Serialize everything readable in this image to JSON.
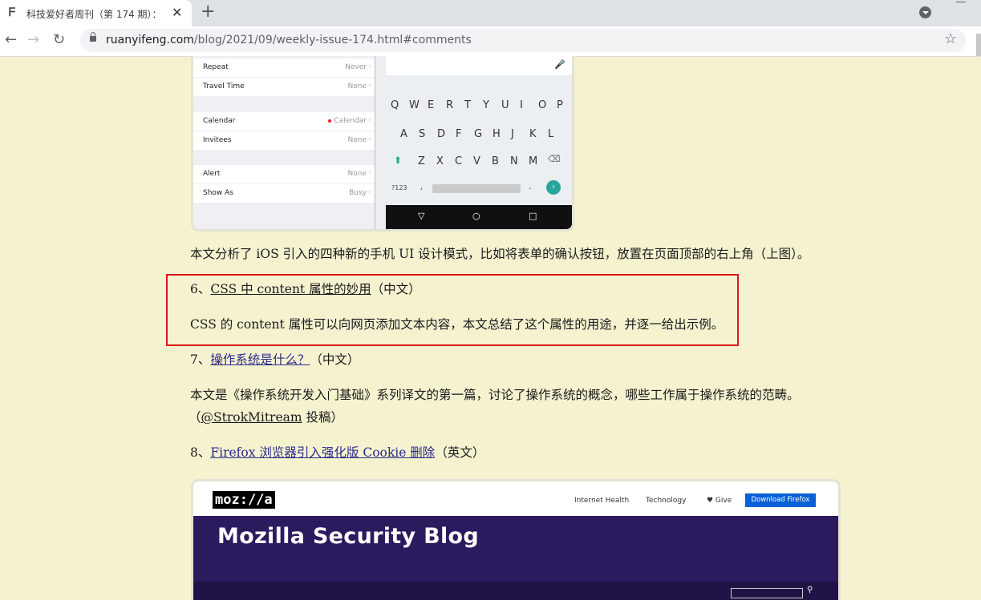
{
  "tab": {
    "favicon": "ᖴ",
    "title": "科技爱好者周刊（第 174 期）：",
    "close": "✕",
    "new_tab": "+"
  },
  "toolbar": {
    "back": "←",
    "forward": "→",
    "reload": "↻",
    "url_host": "ruanyifeng.com",
    "url_path": "/blog/2021/09/weekly-issue-174.html#comments",
    "bookmark": "☆"
  },
  "phone_figure": {
    "ios_rows": [
      {
        "label": "Repeat",
        "value": "Never"
      },
      {
        "label": "Travel Time",
        "value": "None"
      },
      {
        "label": "Calendar",
        "value": "Calendar"
      },
      {
        "label": "Invitees",
        "value": "None"
      },
      {
        "label": "Alert",
        "value": "None"
      },
      {
        "label": "Show As",
        "value": "Busy"
      }
    ],
    "keyboard": {
      "row1": [
        "Q",
        "W",
        "E",
        "R",
        "T",
        "Y",
        "U",
        "I",
        "O",
        "P"
      ],
      "row2": [
        "A",
        "S",
        "D",
        "F",
        "G",
        "H",
        "J",
        "K",
        "L"
      ],
      "row3": [
        "Z",
        "X",
        "C",
        "V",
        "B",
        "N",
        "M"
      ],
      "symbols_key": "?123",
      "comma": ",",
      "period": ".",
      "nav_back": "▽",
      "nav_home": "○",
      "nav_recent": "□"
    }
  },
  "article": {
    "p_ios": "本文分析了 iOS 引入的四种新的手机 UI 设计模式，比如将表单的确认按钮，放置在页面顶部的右上角（上图）。",
    "item6": {
      "num": "6、",
      "link": "CSS 中 content 属性的妙用",
      "lang": "（中文）",
      "desc": "CSS 的 content 属性可以向网页添加文本内容，本文总结了这个属性的用途，并逐一给出示例。"
    },
    "item7": {
      "num": "7、",
      "link": "操作系统是什么？",
      "lang": "（中文）",
      "desc": "本文是《操作系统开发入门基础》系列译文的第一篇，讨论了操作系统的概念，哪些工作属于操作系统的范畴。",
      "credit_open": "（",
      "credit_link": "@StrokMitream",
      "credit_close": " 投稿）"
    },
    "item8": {
      "num": "8、",
      "link": "Firefox 浏览器引入强化版 Cookie 删除",
      "lang": "（英文）"
    }
  },
  "mozilla_figure": {
    "logo": "moz://a",
    "nav": [
      "Internet Health",
      "Technology",
      "♥ Give"
    ],
    "download_button": "Download Firefox",
    "hero_title": "Mozilla Security Blog"
  }
}
